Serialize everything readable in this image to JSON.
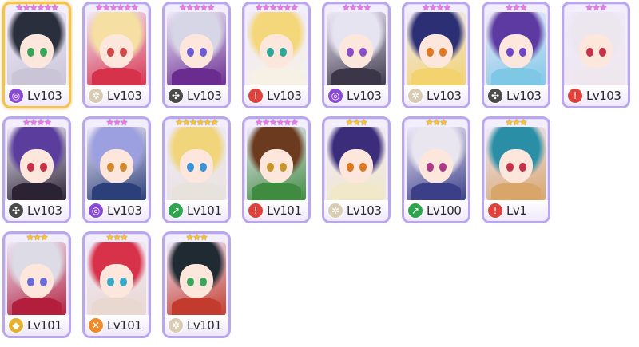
{
  "element_colors": {
    "purple": "#8b49d8",
    "white": "#d8cdb4",
    "black": "#4a4a4a",
    "red": "#e0413b",
    "green": "#2fa44f",
    "gold": "#e5b02a",
    "orange": "#ef8a2a"
  },
  "element_glyphs": {
    "purple": "◎",
    "white": "✲",
    "black": "✣",
    "red": "!",
    "green": "↗",
    "gold": "◆",
    "orange": "✕"
  },
  "cards": [
    {
      "stars": "★★★★★★",
      "star_color": "pink",
      "level": "Lv103",
      "element": "purple",
      "icon": "spiral-element-icon",
      "selected": true,
      "hair": "#2a2f3d",
      "eyes": "#3aa65b",
      "outfit": "#c9c5d6"
    },
    {
      "stars": "★★★★★★",
      "star_color": "pink",
      "level": "Lv103",
      "element": "white",
      "icon": "flower-element-icon",
      "selected": false,
      "hair": "#f5dfa2",
      "eyes": "#d04a4a",
      "outfit": "#d7324b"
    },
    {
      "stars": "★★★★★",
      "star_color": "pink",
      "level": "Lv103",
      "element": "black",
      "icon": "pinwheel-element-icon",
      "selected": false,
      "hair": "#d7d6e6",
      "eyes": "#6c5bd8",
      "outfit": "#6a2c8f"
    },
    {
      "stars": "★★★★★★",
      "star_color": "pink",
      "level": "Lv103",
      "element": "red",
      "icon": "sword-element-icon",
      "selected": false,
      "hair": "#f4d77a",
      "eyes": "#2da79a",
      "outfit": "#f6f1e4"
    },
    {
      "stars": "★★★★",
      "star_color": "pink",
      "level": "Lv103",
      "element": "purple",
      "icon": "spiral-element-icon",
      "selected": false,
      "hair": "#e7e4f1",
      "eyes": "#8a4cc9",
      "outfit": "#3b3648"
    },
    {
      "stars": "★★★★",
      "star_color": "pink",
      "level": "Lv103",
      "element": "white",
      "icon": "flower-element-icon",
      "selected": false,
      "hair": "#2c2f74",
      "eyes": "#e0781f",
      "outfit": "#f2d36d"
    },
    {
      "stars": "★★★",
      "star_color": "pink",
      "level": "Lv103",
      "element": "black",
      "icon": "pinwheel-element-icon",
      "selected": false,
      "hair": "#5c3aa1",
      "eyes": "#6f46c8",
      "outfit": "#7ec8e6"
    },
    {
      "stars": "★★★",
      "star_color": "pink",
      "level": "Lv103",
      "element": "red",
      "icon": "sword-element-icon",
      "selected": false,
      "hair": "#ece6ef",
      "eyes": "#c8314a",
      "outfit": "#efe7ee"
    },
    {
      "stars": "★★★★",
      "star_color": "pink",
      "level": "Lv103",
      "element": "black",
      "icon": "pinwheel-element-icon",
      "selected": false,
      "hair": "#5a3d9c",
      "eyes": "#c8314a",
      "outfit": "#2b2333"
    },
    {
      "stars": "★★★",
      "star_color": "pink",
      "level": "Lv103",
      "element": "purple",
      "icon": "spiral-element-icon",
      "selected": false,
      "hair": "#9c9fe0",
      "eyes": "#d28a2e",
      "outfit": "#2b3f78"
    },
    {
      "stars": "★★★★★★",
      "star_color": "gold",
      "level": "Lv101",
      "element": "green",
      "icon": "arrow-element-icon",
      "selected": false,
      "hair": "#f1d57b",
      "eyes": "#3b93d9",
      "outfit": "#e8e2dc"
    },
    {
      "stars": "★★★★★★",
      "star_color": "pink",
      "level": "Lv101",
      "element": "red",
      "icon": "sword-element-icon",
      "selected": false,
      "hair": "#6b3a1f",
      "eyes": "#c8952b",
      "outfit": "#3f8b3f"
    },
    {
      "stars": "★★★",
      "star_color": "gold",
      "level": "Lv103",
      "element": "white",
      "icon": "flower-element-icon",
      "selected": false,
      "hair": "#3b2d7a",
      "eyes": "#e0781f",
      "outfit": "#f1e7c9"
    },
    {
      "stars": "★★★",
      "star_color": "gold",
      "level": "Lv100",
      "element": "green",
      "icon": "arrow-element-icon",
      "selected": false,
      "hair": "#e9e6f0",
      "eyes": "#b03a8a",
      "outfit": "#3b3f88"
    },
    {
      "stars": "★★★",
      "star_color": "gold",
      "level": "Lv1",
      "element": "red",
      "icon": "sword-element-icon",
      "selected": false,
      "hair": "#2a8fa6",
      "eyes": "#c8314a",
      "outfit": "#d8a56a"
    },
    {
      "stars": "★★★",
      "star_color": "gold",
      "level": "Lv101",
      "element": "gold",
      "icon": "leaf-element-icon",
      "selected": false,
      "hair": "#dcdbe6",
      "eyes": "#6b6bd8",
      "outfit": "#b21e3c"
    },
    {
      "stars": "★★★",
      "star_color": "gold",
      "level": "Lv101",
      "element": "orange",
      "icon": "bow-element-icon",
      "selected": false,
      "hair": "#d8314a",
      "eyes": "#38a8c8",
      "outfit": "#e9d8d0"
    },
    {
      "stars": "★★★",
      "star_color": "gold",
      "level": "Lv101",
      "element": "white",
      "icon": "flower-element-icon",
      "selected": false,
      "hair": "#1f2a33",
      "eyes": "#3aa65b",
      "outfit": "#c33b2d"
    }
  ]
}
